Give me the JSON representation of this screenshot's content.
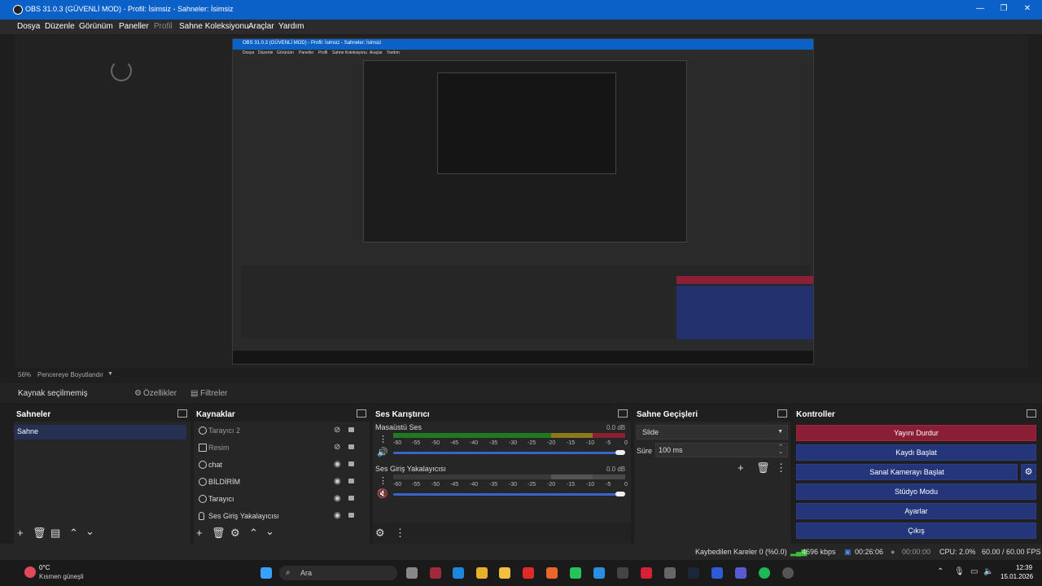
{
  "window": {
    "title": "OBS 31.0.3 (GÜVENLİ MOD) - Profil: İsimsiz - Sahneler: İsimsiz",
    "minimize": "—",
    "maximize": "❐",
    "close": "✕"
  },
  "menu": [
    "Dosya",
    "Düzenle",
    "Görünüm",
    "Paneller",
    "Profil",
    "Sahne Koleksiyonu",
    "Araçlar",
    "Yardım"
  ],
  "preview": {
    "zoom": "56%",
    "resize_label": "Pencereye Boyutlandır"
  },
  "source_toolbar": {
    "no_selection": "Kaynak seçilmemiş",
    "properties": "Özellikler",
    "filters": "Filtreler"
  },
  "scenes": {
    "title": "Sahneler",
    "items": [
      "Sahne"
    ]
  },
  "sources": {
    "title": "Kaynaklar",
    "items": [
      {
        "name": "Tarayıcı 2",
        "visible": false
      },
      {
        "name": "Resim",
        "visible": false
      },
      {
        "name": "chat",
        "visible": true
      },
      {
        "name": "BİLDİRİM",
        "visible": true
      },
      {
        "name": "Tarayıcı",
        "visible": true
      },
      {
        "name": "Ses Giriş Yakalayıcısı",
        "visible": true
      }
    ]
  },
  "mixer": {
    "title": "Ses Karıştırıcı",
    "channels": [
      {
        "name": "Masaüstü Ses",
        "db": "0.0 dB"
      },
      {
        "name": "Ses Giriş Yakalayıcısı",
        "db": "0.0 dB"
      }
    ],
    "ticks": [
      "-60",
      "-55",
      "-50",
      "-45",
      "-40",
      "-35",
      "-30",
      "-25",
      "-20",
      "-15",
      "-10",
      "-5",
      "0"
    ]
  },
  "transitions": {
    "title": "Sahne Geçişleri",
    "selected": "Slide",
    "duration_label": "Süre",
    "duration": "100 ms"
  },
  "controls": {
    "title": "Kontroller",
    "buttons": [
      "Yayını Durdur",
      "Kaydı Başlat",
      "Sanal Kamerayı Başlat",
      "Stüdyo Modu",
      "Ayarlar",
      "Çıkış"
    ]
  },
  "status": {
    "dropped": "Kaybedilen Kareler 0 (%0.0)",
    "bitrate": "4696 kbps",
    "stream_time": "00:26:06",
    "rec_time": "00:00:00",
    "cpu": "CPU: 2.0%",
    "fps": "60.00 / 60.00 FPS"
  },
  "taskbar": {
    "weather_temp": "0°C",
    "weather_desc": "Kısmen güneşli",
    "search": "Ara",
    "time": "12:39",
    "date": "15.01.2026"
  },
  "nested": {
    "title": "OBS 31.0.3 (GÜVENLİ MOD) - Profil: İsimsiz - Sahneler: İsimsiz",
    "menu": [
      "Dosya",
      "Düzenle",
      "Görünüm",
      "Paneller",
      "Profil",
      "Sahne Koleksiyonu",
      "Araçlar",
      "Yardım"
    ]
  },
  "colors": {
    "accent": "#0b61c8",
    "stream_btn": "#8a1e35",
    "control_btn": "#25357a"
  }
}
